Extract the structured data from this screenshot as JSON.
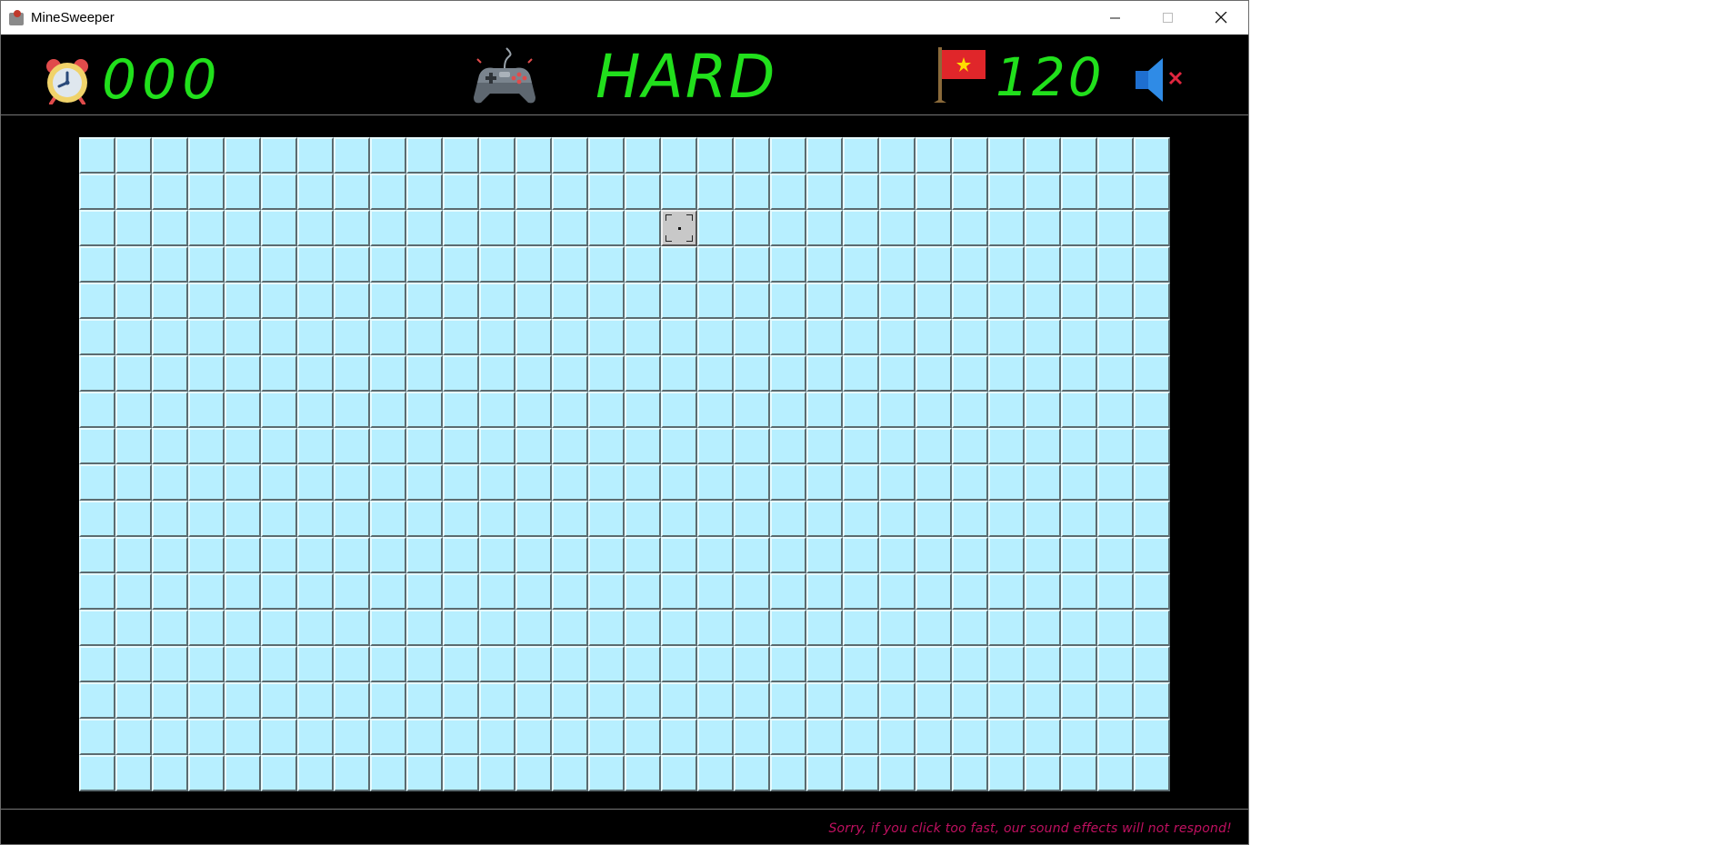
{
  "window": {
    "title": "MineSweeper"
  },
  "header": {
    "timer": "000",
    "difficulty": "HARD",
    "flags_remaining": "120",
    "sound_state": "muted"
  },
  "icons": {
    "app": "minesweeper-app-icon",
    "timer": "alarm-clock-icon",
    "difficulty": "gamepad-icon",
    "flags": "vietnam-flag-icon",
    "sound": "speaker-muted-icon"
  },
  "board": {
    "columns": 30,
    "rows": 18,
    "highlighted_cell": {
      "row": 3,
      "col": 17
    }
  },
  "footer": {
    "note": "Sorry, if you click too fast, our sound effects will not respond!"
  },
  "colors": {
    "accent_green": "#21e01c",
    "cell": "#b7efff",
    "note": "#c01060",
    "background": "#000000"
  }
}
